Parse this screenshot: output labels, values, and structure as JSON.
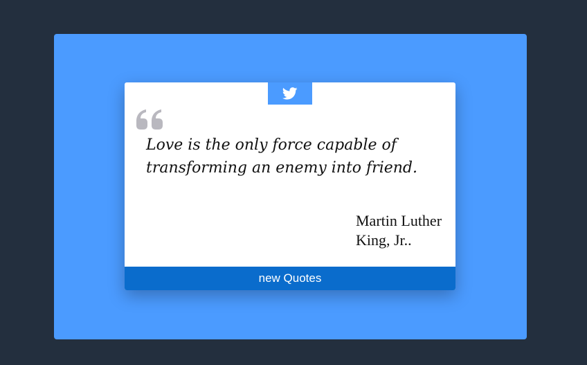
{
  "colors": {
    "page_background": "#232f3e",
    "panel_background": "#4b9bff",
    "card_background": "#ffffff",
    "tweet_button_background": "#4b9bff",
    "new_quote_button_background": "#0a6ccc",
    "quote_mark_color": "#b9b8bf",
    "text_color": "#111111"
  },
  "icons": {
    "tweet": "twitter-bird-icon",
    "quote_mark": "quote-left-icon"
  },
  "quote": {
    "text": "Love is the only force capable of transforming an enemy into friend.",
    "author": "Martin Luther King, Jr.."
  },
  "buttons": {
    "new_quote_label": "new Quotes"
  }
}
